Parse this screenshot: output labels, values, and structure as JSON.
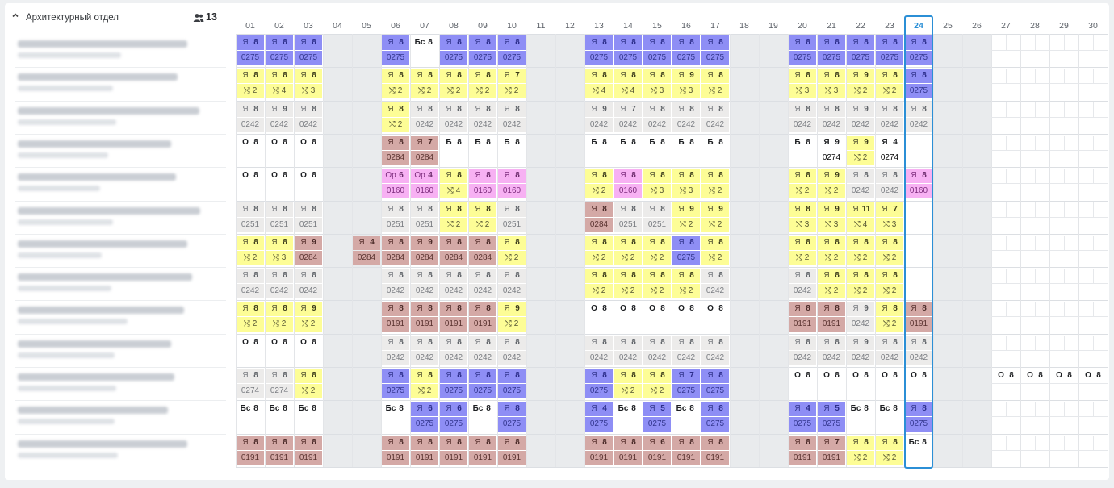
{
  "department": {
    "title": "Архитектурный отдел",
    "collapse_icon": "chevron-up-icon",
    "members_icon": "people-icon",
    "members_count": "13"
  },
  "days": [
    "01",
    "02",
    "03",
    "04",
    "05",
    "06",
    "07",
    "08",
    "09",
    "10",
    "11",
    "12",
    "13",
    "14",
    "15",
    "16",
    "17",
    "18",
    "19",
    "20",
    "21",
    "22",
    "23",
    "24",
    "25",
    "26",
    "27",
    "28",
    "29",
    "30"
  ],
  "weekend_days": [
    "04",
    "05",
    "11",
    "12",
    "18",
    "19",
    "25",
    "26"
  ],
  "selected_day": "24",
  "swap_symbol": "⤭",
  "colors": {
    "blue": "#8e8ef5",
    "yellow": "#fdfd96",
    "gray": "#ecebea",
    "brown": "#d4a9a6",
    "pink": "#f7b1f3",
    "white": "#ffffff",
    "weekend": "#e9ebed",
    "selected_border": "#2b8fd6"
  },
  "employees": [
    {
      "days": {
        "01": "blue|Я|8|0275",
        "02": "blue|Я|8|0275",
        "03": "blue|Я|8|0275",
        "06": "blue|Я|8|0275",
        "07": "white|Бс|8|",
        "08": "blue|Я|8|0275",
        "09": "blue|Я|8|0275",
        "10": "blue|Я|8|0275",
        "13": "blue|Я|8|0275",
        "14": "blue|Я|8|0275",
        "15": "blue|Я|8|0275",
        "16": "blue|Я|8|0275",
        "17": "blue|Я|8|0275",
        "20": "blue|Я|8|0275",
        "21": "blue|Я|8|0275",
        "22": "blue|Я|8|0275",
        "23": "blue|Я|8|0275",
        "24": "blue|Я|8|0275"
      }
    },
    {
      "days": {
        "01": "yellow|Я|8|S2",
        "02": "yellow|Я|8|S4",
        "03": "yellow|Я|8|S3",
        "06": "yellow|Я|8|S2",
        "07": "yellow|Я|8|S2",
        "08": "yellow|Я|8|S2",
        "09": "yellow|Я|8|S2",
        "10": "yellow|Я|7|S2",
        "13": "yellow|Я|8|S4",
        "14": "yellow|Я|8|S4",
        "15": "yellow|Я|8|S3",
        "16": "yellow|Я|9|S3",
        "17": "yellow|Я|8|S2",
        "20": "yellow|Я|8|S3",
        "21": "yellow|Я|8|S3",
        "22": "yellow|Я|9|S2",
        "23": "yellow|Я|8|S2",
        "24": "blue|Я|8|0275"
      }
    },
    {
      "days": {
        "01": "gray|Я|8|0242",
        "02": "gray|Я|9|0242",
        "03": "gray|Я|8|0242",
        "06": "yellow|Я|8|S2",
        "07": "gray|Я|8|0242",
        "08": "gray|Я|8|0242",
        "09": "gray|Я|8|0242",
        "10": "gray|Я|8|0242",
        "13": "gray|Я|9|0242",
        "14": "gray|Я|7|0242",
        "15": "gray|Я|8|0242",
        "16": "gray|Я|8|0242",
        "17": "gray|Я|8|0242",
        "20": "gray|Я|8|0242",
        "21": "gray|Я|8|0242",
        "22": "gray|Я|9|0242",
        "23": "gray|Я|8|0242",
        "24": "gray|Я|8|0242"
      }
    },
    {
      "days": {
        "01": "white|О|8|",
        "02": "white|О|8|",
        "03": "white|О|8|",
        "06": "brown|Я|8|0284",
        "07": "brown|Я|7|0284",
        "08": "white|Б|8|",
        "09": "white|Б|8|",
        "10": "white|Б|8|",
        "13": "white|Б|8|",
        "14": "white|Б|8|",
        "15": "white|Б|8|",
        "16": "white|Б|8|",
        "17": "white|Б|8|",
        "20": "white|Б|8|",
        "21": "white|Я|9|0274",
        "22": "yellow|Я|9|S2",
        "23": "white|Я|4|0274"
      }
    },
    {
      "days": {
        "01": "white|О|8|",
        "02": "white|О|8|",
        "03": "white|О|8|",
        "06": "pink|Ор|6|0160",
        "07": "pink|Ор|4|0160",
        "08": "yellow|Я|8|S4",
        "09": "pink|Я|8|0160",
        "10": "pink|Я|8|0160",
        "13": "yellow|Я|8|S2",
        "14": "pink|Я|8|0160",
        "15": "yellow|Я|8|S3",
        "16": "yellow|Я|8|S3",
        "17": "yellow|Я|8|S2",
        "20": "yellow|Я|8|S2",
        "21": "yellow|Я|9|S2",
        "22": "gray|Я|8|0242",
        "23": "gray|Я|8|0242",
        "24": "pink|Я|8|0160"
      }
    },
    {
      "days": {
        "01": "gray|Я|8|0251",
        "02": "gray|Я|8|0251",
        "03": "gray|Я|8|0251",
        "06": "gray|Я|8|0251",
        "07": "gray|Я|8|0251",
        "08": "yellow|Я|8|S2",
        "09": "yellow|Я|8|S2",
        "10": "gray|Я|8|0251",
        "13": "brown|Я|8|0284",
        "14": "gray|Я|8|0251",
        "15": "gray|Я|8|0251",
        "16": "yellow|Я|9|S2",
        "17": "yellow|Я|9|S2",
        "20": "yellow|Я|8|S3",
        "21": "yellow|Я|9|S3",
        "22": "yellow|Я|11|S4",
        "23": "yellow|Я|7|S3"
      }
    },
    {
      "days": {
        "01": "yellow|Я|8|S2",
        "02": "yellow|Я|8|S3",
        "03": "brown|Я|9|0284",
        "05": "brown|Я|4|0284",
        "06": "brown|Я|8|0284",
        "07": "brown|Я|9|0284",
        "08": "brown|Я|8|0284",
        "09": "brown|Я|8|0284",
        "10": "yellow|Я|8|S2",
        "13": "yellow|Я|8|S2",
        "14": "yellow|Я|8|S2",
        "15": "yellow|Я|8|S2",
        "16": "blue|Я|8|0275",
        "17": "yellow|Я|8|S2",
        "20": "yellow|Я|8|S2",
        "21": "yellow|Я|8|S2",
        "22": "yellow|Я|8|S2",
        "23": "yellow|Я|8|S2"
      }
    },
    {
      "days": {
        "01": "gray|Я|8|0242",
        "02": "gray|Я|8|0242",
        "03": "gray|Я|8|0242",
        "06": "gray|Я|8|0242",
        "07": "gray|Я|8|0242",
        "08": "gray|Я|8|0242",
        "09": "gray|Я|8|0242",
        "10": "gray|Я|8|0242",
        "13": "yellow|Я|8|S2",
        "14": "yellow|Я|8|S2",
        "15": "yellow|Я|8|S2",
        "16": "yellow|Я|8|S2",
        "17": "gray|Я|8|0242",
        "20": "gray|Я|8|0242",
        "21": "yellow|Я|8|S2",
        "22": "yellow|Я|8|S2",
        "23": "yellow|Я|8|S2"
      }
    },
    {
      "days": {
        "01": "yellow|Я|8|S2",
        "02": "yellow|Я|8|S2",
        "03": "yellow|Я|9|S2",
        "06": "brown|Я|8|0191",
        "07": "brown|Я|8|0191",
        "08": "brown|Я|8|0191",
        "09": "brown|Я|8|0191",
        "10": "yellow|Я|9|S2",
        "13": "white|О|8|",
        "14": "white|О|8|",
        "15": "white|О|8|",
        "16": "white|О|8|",
        "17": "white|О|8|",
        "20": "brown|Я|8|0191",
        "21": "brown|Я|8|0191",
        "22": "gray|Я|9|0242",
        "23": "yellow|Я|8|S2",
        "24": "brown|Я|8|0191"
      }
    },
    {
      "days": {
        "01": "white|О|8|",
        "02": "white|О|8|",
        "03": "white|О|8|",
        "06": "gray|Я|8|0242",
        "07": "gray|Я|8|0242",
        "08": "gray|Я|8|0242",
        "09": "gray|Я|8|0242",
        "10": "gray|Я|8|0242",
        "13": "gray|Я|8|0242",
        "14": "gray|Я|8|0242",
        "15": "gray|Я|8|0242",
        "16": "gray|Я|8|0242",
        "17": "gray|Я|8|0242",
        "20": "gray|Я|8|0242",
        "21": "gray|Я|8|0242",
        "22": "gray|Я|9|0242",
        "23": "gray|Я|8|0242",
        "24": "gray|Я|8|0242"
      }
    },
    {
      "days": {
        "01": "gray|Я|8|0274",
        "02": "gray|Я|8|0274",
        "03": "yellow|Я|8|S2",
        "06": "blue|Я|8|0275",
        "07": "yellow|Я|8|S2",
        "08": "blue|Я|8|0275",
        "09": "blue|Я|8|0275",
        "10": "blue|Я|8|0275",
        "13": "blue|Я|8|0275",
        "14": "yellow|Я|8|S2",
        "15": "yellow|Я|8|S2",
        "16": "blue|Я|7|0275",
        "17": "blue|Я|8|0275",
        "20": "white|О|8|",
        "21": "white|О|8|",
        "22": "white|О|8|",
        "23": "white|О|8|",
        "24": "white|О|8|",
        "27": "white|О|8|",
        "28": "white|О|8|",
        "29": "white|О|8|",
        "30": "white|О|8|"
      }
    },
    {
      "days": {
        "01": "white|Бс|8|",
        "02": "white|Бс|8|",
        "03": "white|Бс|8|",
        "06": "white|Бс|8|",
        "07": "blue|Я|6|0275",
        "08": "blue|Я|6|0275",
        "09": "white|Бс|8|",
        "10": "blue|Я|8|0275",
        "13": "blue|Я|4|0275",
        "14": "white|Бс|8|",
        "15": "blue|Я|5|0275",
        "16": "white|Бс|8|",
        "17": "blue|Я|8|0275",
        "20": "blue|Я|4|0275",
        "21": "blue|Я|5|0275",
        "22": "white|Бс|8|",
        "23": "white|Бс|8|",
        "24": "blue|Я|8|0275"
      }
    },
    {
      "days": {
        "01": "brown|Я|8|0191",
        "02": "brown|Я|8|0191",
        "03": "brown|Я|8|0191",
        "06": "brown|Я|8|0191",
        "07": "brown|Я|8|0191",
        "08": "brown|Я|8|0191",
        "09": "brown|Я|8|0191",
        "10": "brown|Я|8|0191",
        "13": "brown|Я|8|0191",
        "14": "brown|Я|8|0191",
        "15": "brown|Я|6|0191",
        "16": "brown|Я|8|0191",
        "17": "brown|Я|8|0191",
        "20": "brown|Я|8|0191",
        "21": "brown|Я|7|0191",
        "22": "yellow|Я|8|S2",
        "23": "yellow|Я|8|S2",
        "24": "white|Бс|8|"
      }
    }
  ]
}
